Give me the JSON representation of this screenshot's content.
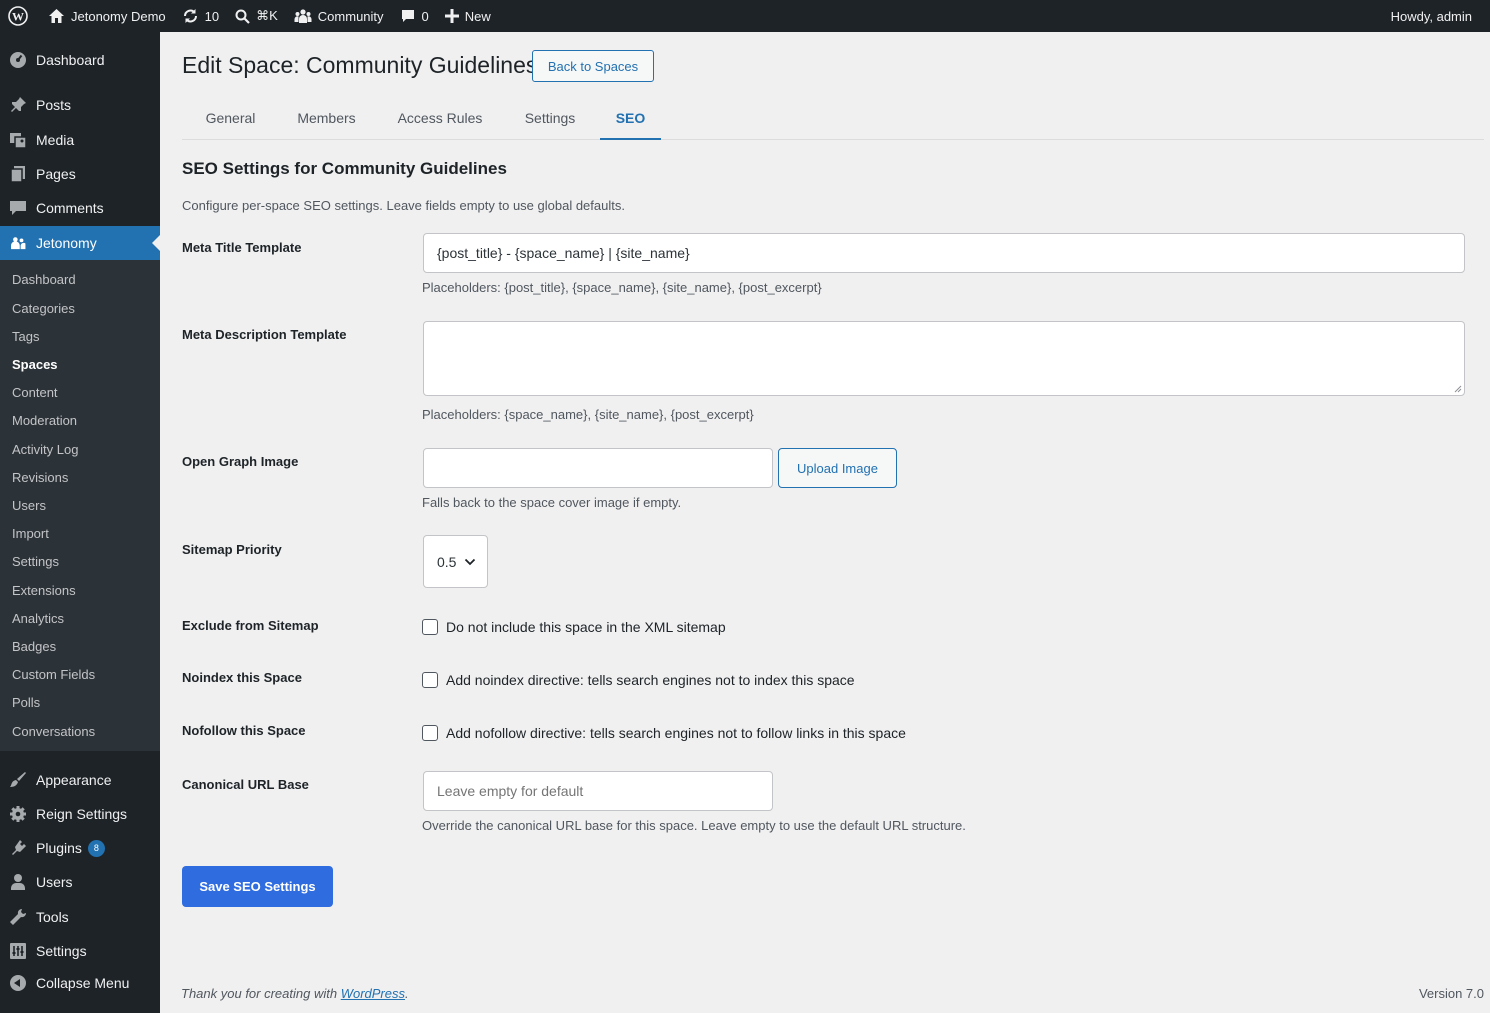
{
  "admin_bar": {
    "site_name": "Jetonomy Demo",
    "updates_count": "10",
    "search_shortcut": "⌘K",
    "community_label": "Community",
    "comments_count": "0",
    "new_label": "New",
    "greeting": "Howdy, admin"
  },
  "sidebar": {
    "top_items": [
      {
        "label": "Dashboard",
        "icon": "dashboard-icon"
      },
      {
        "label": "Posts",
        "icon": "pin-icon"
      },
      {
        "label": "Media",
        "icon": "media-icon"
      },
      {
        "label": "Pages",
        "icon": "pages-icon"
      },
      {
        "label": "Comments",
        "icon": "comment-icon"
      },
      {
        "label": "Jetonomy",
        "icon": "groups-icon"
      }
    ],
    "submenu": [
      "Dashboard",
      "Categories",
      "Tags",
      "Spaces",
      "Content",
      "Moderation",
      "Activity Log",
      "Revisions",
      "Users",
      "Import",
      "Settings",
      "Extensions",
      "Analytics",
      "Badges",
      "Custom Fields",
      "Polls",
      "Conversations"
    ],
    "current_submenu": "Spaces",
    "bottom_items": [
      {
        "label": "Appearance",
        "icon": "brush-icon"
      },
      {
        "label": "Reign Settings",
        "icon": "gear-icon"
      },
      {
        "label": "Plugins",
        "icon": "plugin-icon",
        "badge": "8"
      },
      {
        "label": "Users",
        "icon": "user-icon"
      },
      {
        "label": "Tools",
        "icon": "wrench-icon"
      },
      {
        "label": "Settings",
        "icon": "settings-icon"
      },
      {
        "label": "Collapse Menu",
        "icon": "collapse-icon"
      }
    ]
  },
  "page": {
    "title": "Edit Space: Community Guidelines",
    "back_button": "Back to Spaces",
    "tabs": [
      "General",
      "Members",
      "Access Rules",
      "Settings",
      "SEO"
    ],
    "active_tab": "SEO",
    "section_title": "SEO Settings for Community Guidelines",
    "section_desc": "Configure per-space SEO settings. Leave fields empty to use global defaults."
  },
  "form": {
    "meta_title": {
      "label": "Meta Title Template",
      "value": "{post_title} - {space_name} | {site_name}",
      "help": "Placeholders: {post_title}, {space_name}, {site_name}, {post_excerpt}"
    },
    "meta_description": {
      "label": "Meta Description Template",
      "value": "",
      "help": "Placeholders: {space_name}, {site_name}, {post_excerpt}"
    },
    "og_image": {
      "label": "Open Graph Image",
      "value": "",
      "button": "Upload Image",
      "help": "Falls back to the space cover image if empty."
    },
    "sitemap_priority": {
      "label": "Sitemap Priority",
      "value": "0.5"
    },
    "exclude_sitemap": {
      "label": "Exclude from Sitemap",
      "checkbox_label": "Do not include this space in the XML sitemap",
      "checked": false
    },
    "noindex": {
      "label": "Noindex this Space",
      "checkbox_label": "Add noindex directive: tells search engines not to index this space",
      "checked": false
    },
    "nofollow": {
      "label": "Nofollow this Space",
      "checkbox_label": "Add nofollow directive: tells search engines not to follow links in this space",
      "checked": false
    },
    "canonical": {
      "label": "Canonical URL Base",
      "placeholder": "Leave empty for default",
      "help": "Override the canonical URL base for this space. Leave empty to use the default URL structure."
    },
    "save_button": "Save SEO Settings"
  },
  "footer": {
    "thanks_prefix": "Thank you for creating with ",
    "thanks_link": "WordPress",
    "thanks_suffix": ".",
    "version": "Version 7.0"
  },
  "colors": {
    "admin_bg": "#1d2327",
    "accent": "#2271b1",
    "primary_button": "#2f6ce0"
  }
}
